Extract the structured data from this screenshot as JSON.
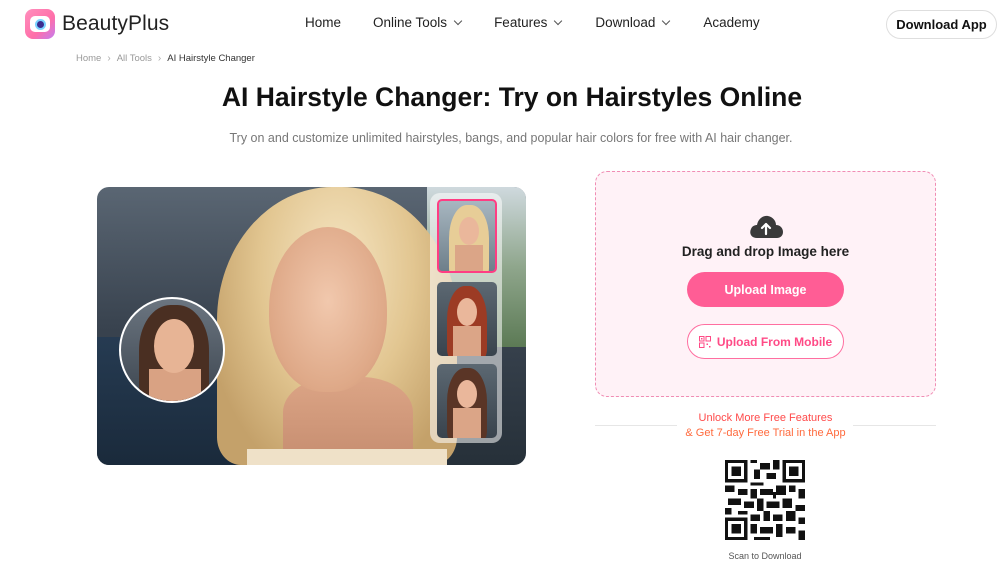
{
  "brand": {
    "name": "BeautyPlus"
  },
  "nav": {
    "home": "Home",
    "online_tools": "Online Tools",
    "features": "Features",
    "download": "Download",
    "academy": "Academy"
  },
  "header": {
    "download_app": "Download App"
  },
  "breadcrumb": {
    "home": "Home",
    "all_tools": "All Tools",
    "current": "AI Hairstyle Changer"
  },
  "hero": {
    "title": "AI Hairstyle Changer: Try on Hairstyles Online",
    "subtitle": "Try on and customize unlimited hairstyles, bangs, and popular hair colors for free with AI hair changer."
  },
  "upload": {
    "drop_text": "Drag and drop Image here",
    "upload_button": "Upload Image",
    "mobile_button": "Upload From Mobile"
  },
  "promo": {
    "line1": "Unlock More Free Features",
    "line2": "& Get 7-day Free Trial in the App"
  },
  "qr": {
    "caption": "Scan to Download"
  },
  "colors": {
    "accent": "#ff5d95",
    "panel_bg": "#fff2f7",
    "promo": "#ff4a4a"
  }
}
